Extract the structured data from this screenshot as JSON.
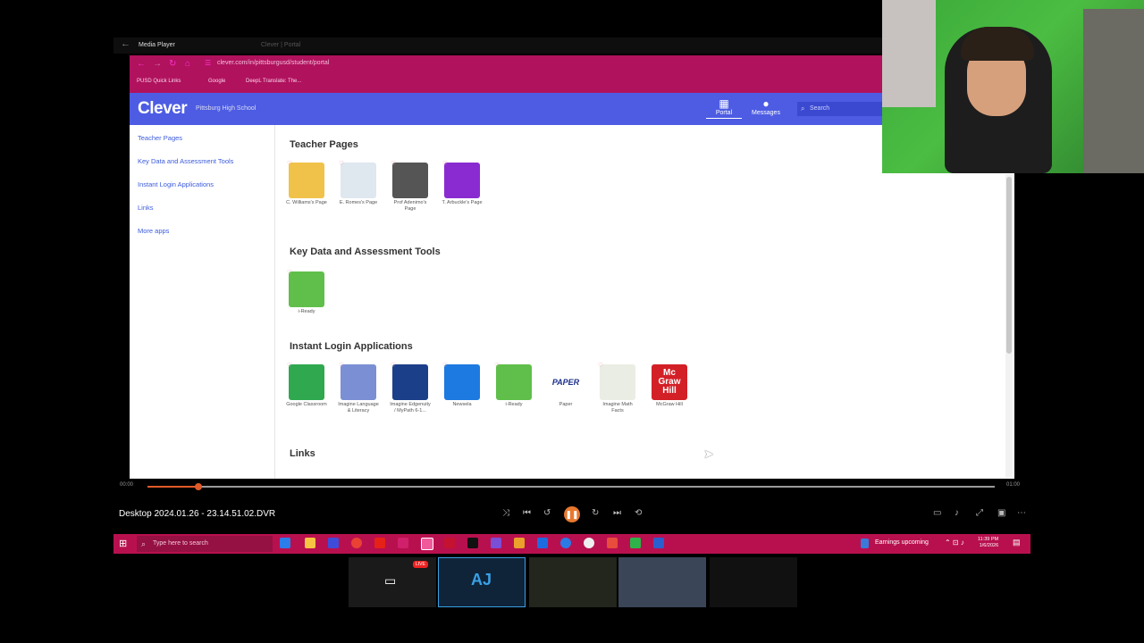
{
  "media_player": {
    "title": "Media Player",
    "tab_clever": "Clever | Portal",
    "time_elapsed": "00:00",
    "time_total": "01:00",
    "file_title": "Desktop 2024.01.26 - 23.14.51.02.DVR",
    "playback_progress": 0.06
  },
  "browser": {
    "address": "clever.com/in/pittsburgusd/student/portal",
    "bookmarks": [
      "PUSD Quick Links",
      "Google",
      "DeepL Translate: The..."
    ]
  },
  "clever": {
    "logo": "Clever",
    "school": "Pittsburg High School",
    "portal_label": "Portal",
    "messages_label": "Messages",
    "search_placeholder": "Search",
    "sidebar": [
      "Teacher Pages",
      "Key Data and Assessment Tools",
      "Instant Login Applications",
      "Links",
      "More apps"
    ],
    "sections": {
      "teacher_pages": {
        "title": "Teacher Pages",
        "apps": [
          {
            "label": "C. Williams's Page",
            "color": "#f1c24a"
          },
          {
            "label": "E. Romes's Page",
            "color": "#dfe7ef"
          },
          {
            "label": "Prof Adenimo's Page",
            "color": "#555555"
          },
          {
            "label": "T. Arbuckle's Page",
            "color": "#8a2bd2"
          }
        ]
      },
      "key_data": {
        "title": "Key Data and Assessment Tools",
        "apps": [
          {
            "label": "i-Ready",
            "color": "#5fbf4a"
          }
        ]
      },
      "instant_login": {
        "title": "Instant Login Applications",
        "apps": [
          {
            "label": "Google Classroom",
            "color": "#2fa84f"
          },
          {
            "label": "Imagine Language & Literacy",
            "color": "#7b8fd4"
          },
          {
            "label": "Imagine Edgenuity / MyPath 6-1...",
            "color": "#1c3f8a"
          },
          {
            "label": "Newsela",
            "color": "#1d7ae0"
          },
          {
            "label": "i-Ready",
            "color": "#5fbf4a"
          },
          {
            "label": "Paper",
            "color": "#ffffff",
            "text": "PAPER"
          },
          {
            "label": "Imagine Math Facts",
            "color": "#e9ede4"
          },
          {
            "label": "McGraw Hill",
            "color": "#d32027",
            "text": "Mc Graw Hill"
          }
        ]
      },
      "links": {
        "title": "Links"
      }
    }
  },
  "taskbar": {
    "search_placeholder": "Type here to search",
    "earnings": "Earnings upcoming",
    "time": "11:39 PM",
    "date": "1/6/2026"
  },
  "colors": {
    "clever_blue": "#4d5ce3",
    "browser_magenta": "#b0125e",
    "taskbar_magenta": "#b8104e",
    "accent_orange": "#e25a2a"
  }
}
